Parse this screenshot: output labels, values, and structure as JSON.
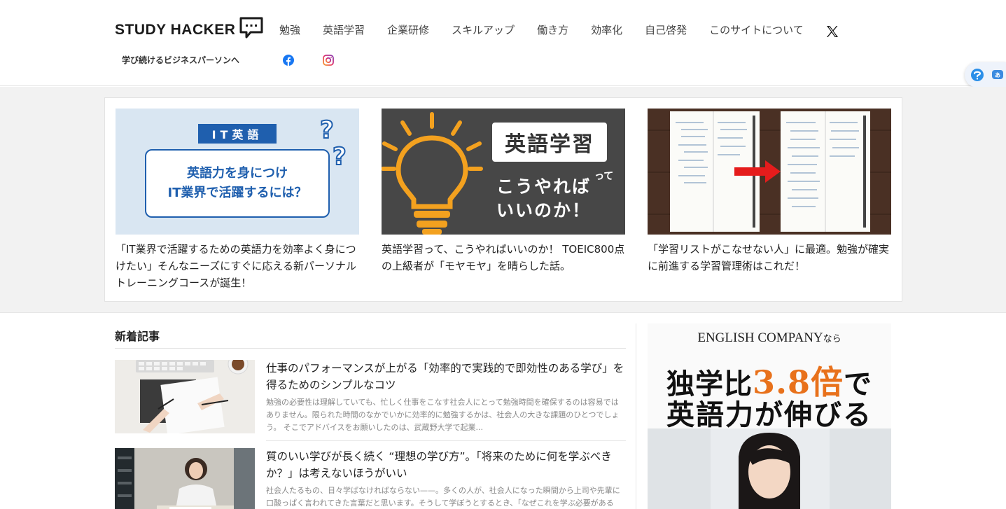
{
  "header": {
    "logo_text": "STUDY HACKER",
    "tagline": "学び続けるビジネスパーソンへ",
    "nav": [
      "勉強",
      "英語学習",
      "企業研修",
      "スキルアップ",
      "働き方",
      "効率化",
      "自己啓発",
      "このサイトについて"
    ]
  },
  "featured": [
    {
      "thumb_badge": "IT英語",
      "thumb_text1": "英語力を身につけ",
      "thumb_text2": "IT業界で活躍するには？",
      "title": "「IT業界で活躍するための英語力を効率よく身につけたい」そんなニーズにすぐに応える新パーソナルトレーニングコースが誕生！"
    },
    {
      "thumb_badge": "英語学習",
      "thumb_text1": "こうやれば",
      "thumb_text2": "いいのか！",
      "thumb_small": "って",
      "title": "英語学習って、こうやればいいのか！ TOEIC800点の上級者が「モヤモヤ」を晴らした話。"
    },
    {
      "title": "「学習リストがこなせない人」に最適。勉強が確実に前進する学習管理術はこれだ！"
    }
  ],
  "latest": {
    "heading": "新着記事",
    "articles": [
      {
        "title": "仕事のパフォーマンスが上がる「効率的で実践的で即効性のある学び」を得るためのシンプルなコツ",
        "excerpt": "勉強の必要性は理解していても、忙しく仕事をこなす社会人にとって勉強時間を確保するのは容易ではありません。限られた時間のなかでいかに効率的に勉強するかは、社会人の大きな課題のひとつでしょう。 そこでアドバイスをお願いしたのは、武蔵野大学で起業..."
      },
      {
        "title": "質のいい学びが長く続く “理想の学び方”。「将来のために何を学ぶべきか？」は考えないほうがいい",
        "excerpt": "社会人たるもの、日々学ばなければならない——。多くの人が、社会人になった瞬間から上司や先輩に口酸っぱく言われてきた言葉だと思います。そうして学ぼうとするとき、「なぜこれを学ぶ必要がある"
      }
    ]
  },
  "ad": {
    "line1_main": "ENGLISH COMPANY",
    "line1_suffix": "なら",
    "line2_pre": "独学比",
    "line2_accent": "3.8倍",
    "line2_post": "で",
    "line3": "英語力が伸びる"
  },
  "colors": {
    "it_banner_bg": "#d9e6f2",
    "it_banner_blue": "#1f5fae",
    "bulb_bg": "#474747",
    "bulb_orange": "#f3a11f",
    "wood_bg": "#4a3024",
    "accent_orange": "#e8711b"
  }
}
